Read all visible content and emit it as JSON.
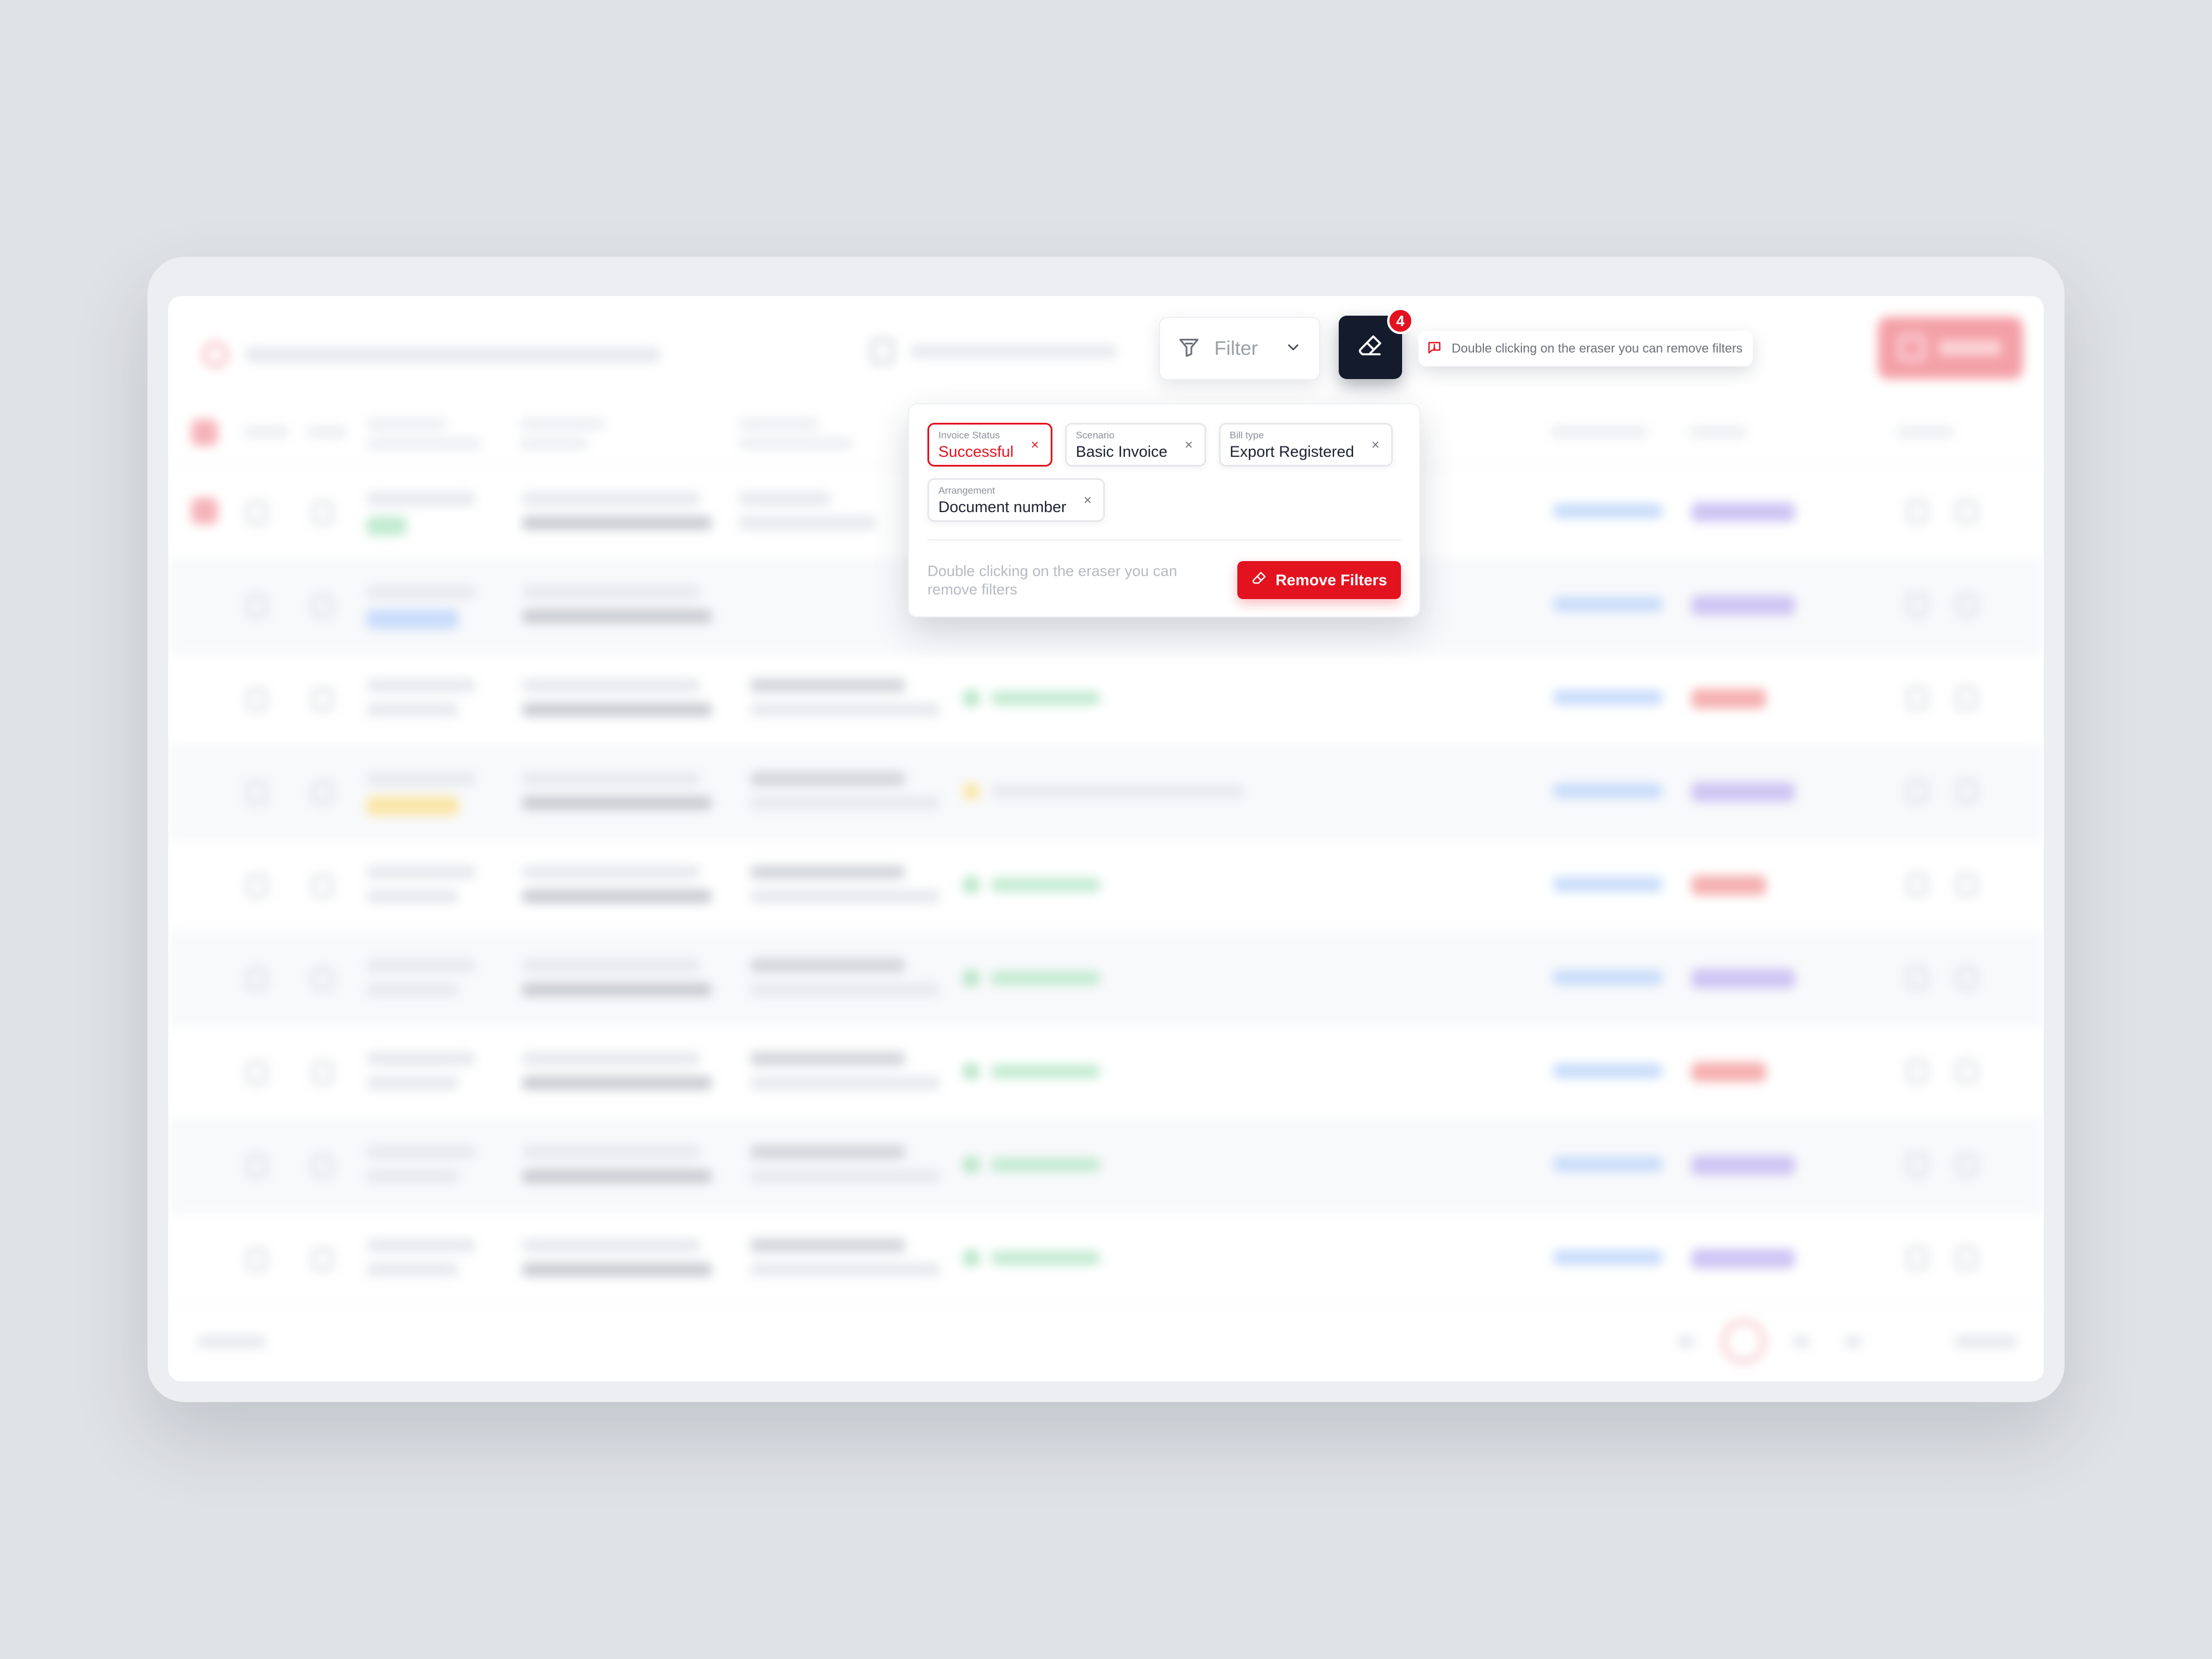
{
  "toolbar": {
    "filter_label": "Filter",
    "eraser_badge": "4",
    "tooltip": "Double clicking on the eraser you can remove filters"
  },
  "filters": {
    "chips": [
      {
        "caption": "Invoice Status",
        "value": "Successful",
        "active": true
      },
      {
        "caption": "Scenario",
        "value": "Basic Invoice",
        "active": false
      },
      {
        "caption": "Bill type",
        "value": "Export Registered",
        "active": false
      },
      {
        "caption": "Arrangement",
        "value": "Document number",
        "active": false
      }
    ],
    "hint": "Double clicking on the eraser you can remove filters",
    "remove_label": "Remove Filters",
    "close_glyph": "×"
  },
  "icons": {
    "filter": "filter-funnel-icon",
    "chevron": "chevron-down-icon",
    "eraser": "eraser-icon",
    "info": "info-speech-icon",
    "remove": "eraser-small-icon"
  },
  "colors": {
    "accent": "#e3121f",
    "dark_button": "#141b2d"
  }
}
